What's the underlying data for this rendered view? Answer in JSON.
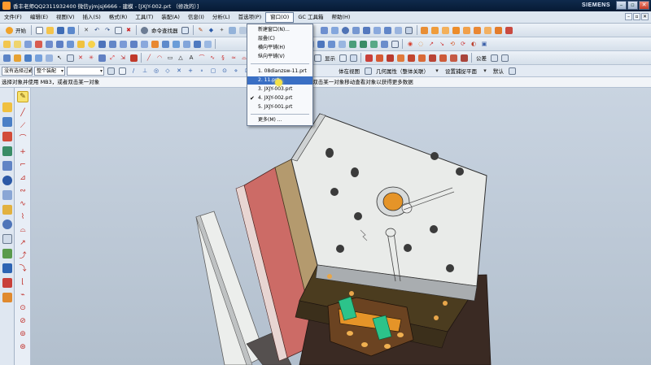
{
  "window": {
    "title": "香丰老师QQ2311932400 微信yjmjsj6666 - 建模 - [JXJY-002.prt （修改的）]",
    "brand": "SIEMENS",
    "buttons": {
      "minimize": "–",
      "maximize": "▫",
      "close": "✕"
    }
  },
  "menubar": {
    "items": [
      {
        "label": "文件(F)",
        "name": "menu-file"
      },
      {
        "label": "编辑(E)",
        "name": "menu-edit"
      },
      {
        "label": "视图(V)",
        "name": "menu-view"
      },
      {
        "label": "插入(S)",
        "name": "menu-insert"
      },
      {
        "label": "格式(R)",
        "name": "menu-format"
      },
      {
        "label": "工具(T)",
        "name": "menu-tools"
      },
      {
        "label": "装配(A)",
        "name": "menu-assemblies"
      },
      {
        "label": "信息(I)",
        "name": "menu-information"
      },
      {
        "label": "分析(L)",
        "name": "menu-analysis"
      },
      {
        "label": "首选项(P)",
        "name": "menu-preferences"
      },
      {
        "label": "窗口(O)",
        "name": "menu-window"
      },
      {
        "label": "GC 工具箱",
        "name": "menu-gc-toolkit"
      },
      {
        "label": "帮助(H)",
        "name": "menu-help"
      }
    ],
    "mini": [
      "–",
      "▫",
      "✕"
    ]
  },
  "toolbar1": {
    "start_label": "开始",
    "cmd_finder_label": "命令查找器"
  },
  "toolbar3": {
    "show_label": "显示",
    "tolerance_label": "公差"
  },
  "selectionbar": {
    "filter": "没有选择过滤器",
    "scope": "整个装配",
    "type_filter": "",
    "view_label": "体在视图",
    "feature_label": "几何属性（整体关联）",
    "mode_label": "设置捕捉平面",
    "default_label": "默认"
  },
  "cuebar": {
    "prompt": "选择对象并使用 MB3，或者双击某一对象",
    "status": "选择对象并使用 MB3，或者双击某一对象移动查看对象以获得更多数据"
  },
  "window_menu": {
    "items": [
      {
        "label": "新建窗口(N)...",
        "name": "dd-new-window"
      },
      {
        "label": "层叠(C)",
        "name": "dd-cascade"
      },
      {
        "label": "横向平铺(H)",
        "name": "dd-tile-horizontal"
      },
      {
        "label": "纵向平铺(V)",
        "name": "dd-tile-vertical"
      },
      {
        "label": "1. 08dianzsw-11.prt",
        "name": "dd-file-1"
      },
      {
        "label": "2. 11.prt",
        "name": "dd-file-2"
      },
      {
        "label": "3. JXJY-003.prt",
        "name": "dd-file-3"
      },
      {
        "label": "4. JXJY-002.prt",
        "name": "dd-file-4"
      },
      {
        "label": "5. JXJY-001.prt",
        "name": "dd-file-5"
      },
      {
        "label": "更多(M) ...",
        "name": "dd-more"
      }
    ],
    "highlighted_index": 5,
    "checked_index": 7
  },
  "colors": {
    "plate_face": "#e9ebe9",
    "plate_side_dark": "#3a2a23",
    "red_plate": "#cc6b66",
    "tan_plate": "#b49a6e",
    "insert_orange": "#e59428",
    "slider_green": "#2cc38a",
    "menu_highlight": "#3a6fc4"
  }
}
